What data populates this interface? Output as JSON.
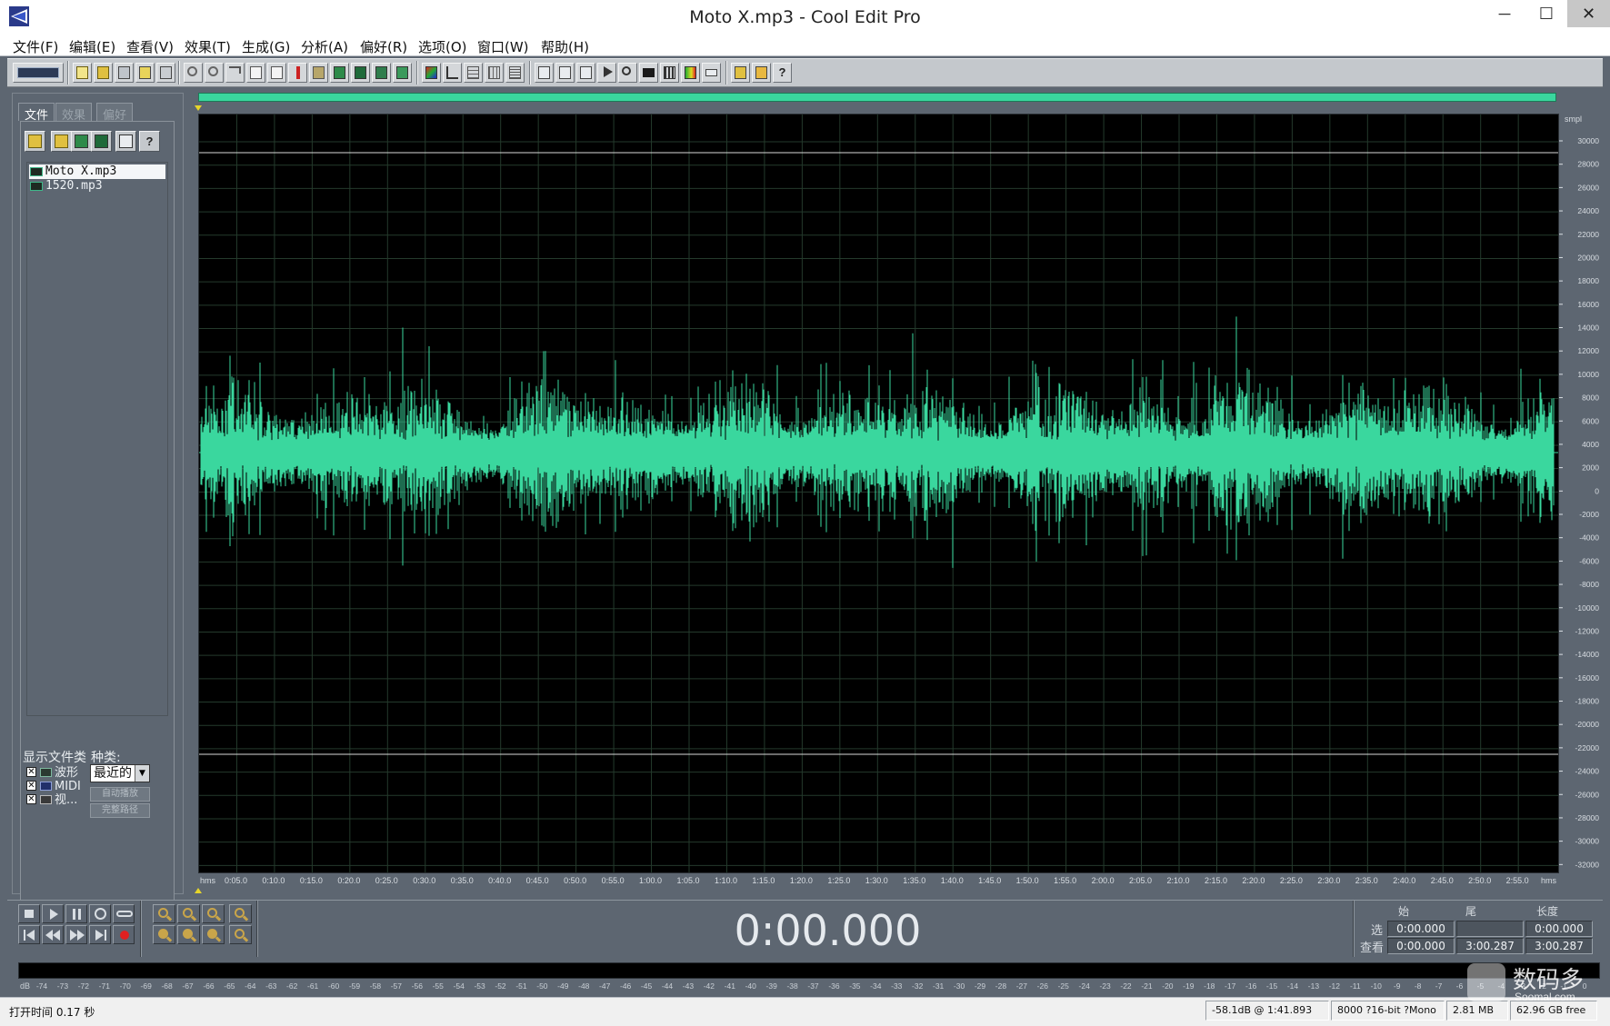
{
  "window": {
    "title": "Moto X.mp3 - Cool Edit Pro",
    "minimize_glyph": "─",
    "maximize_glyph": "☐",
    "close_glyph": "✕"
  },
  "menu": {
    "items": [
      "文件(F)",
      "编辑(E)",
      "查看(V)",
      "效果(T)",
      "生成(G)",
      "分析(A)",
      "偏好(R)",
      "选项(O)",
      "窗口(W)",
      "帮助(H)"
    ]
  },
  "organizer": {
    "tabs": [
      "文件",
      "效果",
      "偏好"
    ],
    "files": [
      {
        "name": "Moto X.mp3",
        "selected": true
      },
      {
        "name": "1520.mp3",
        "selected": false
      }
    ],
    "show_types_label": "显示文件类",
    "kind_label": "种类:",
    "types": [
      {
        "name": "波形",
        "checked": "✕"
      },
      {
        "name": "MIDI",
        "checked": "✕"
      },
      {
        "name": "视...",
        "checked": "✕"
      }
    ],
    "kind_value": "最近的",
    "auto_play_label": "自动播放",
    "full_path_label": "完整路径"
  },
  "waveform": {
    "wave_color": "#3ad79e",
    "background": "#000000",
    "grid_color": "#243a2c",
    "amp_unit": "smpl",
    "amp_ticks": [
      "30000",
      "28000",
      "26000",
      "24000",
      "22000",
      "20000",
      "18000",
      "16000",
      "14000",
      "12000",
      "10000",
      "8000",
      "6000",
      "4000",
      "2000",
      "0",
      "-2000",
      "-4000",
      "-6000",
      "-8000",
      "-10000",
      "-12000",
      "-14000",
      "-16000",
      "-18000",
      "-20000",
      "-22000",
      "-24000",
      "-26000",
      "-28000",
      "-30000",
      "-32000"
    ],
    "time_unit": "hms",
    "time_ticks": [
      "0:05.0",
      "0:10.0",
      "0:15.0",
      "0:20.0",
      "0:25.0",
      "0:30.0",
      "0:35.0",
      "0:40.0",
      "0:45.0",
      "0:50.0",
      "0:55.0",
      "1:00.0",
      "1:05.0",
      "1:10.0",
      "1:15.0",
      "1:20.0",
      "1:25.0",
      "1:30.0",
      "1:35.0",
      "1:40.0",
      "1:45.0",
      "1:50.0",
      "1:55.0",
      "2:00.0",
      "2:05.0",
      "2:10.0",
      "2:15.0",
      "2:20.0",
      "2:25.0",
      "2:30.0",
      "2:35.0",
      "2:40.0",
      "2:45.0",
      "2:50.0",
      "2:55.0"
    ]
  },
  "transport": {
    "time": "0:00.000",
    "headers": [
      "始",
      "尾",
      "长度"
    ],
    "row_select_label": "选",
    "row_view_label": "查看",
    "select": {
      "begin": "0:00.000",
      "end": "",
      "length": "0:00.000"
    },
    "view": {
      "begin": "0:00.000",
      "end": "3:00.287",
      "length": "3:00.287"
    }
  },
  "meter": {
    "unit": "dB",
    "ticks": [
      "-74",
      "-73",
      "-72",
      "-71",
      "-70",
      "-69",
      "-68",
      "-67",
      "-66",
      "-65",
      "-64",
      "-63",
      "-62",
      "-61",
      "-60",
      "-59",
      "-58",
      "-57",
      "-56",
      "-55",
      "-54",
      "-53",
      "-52",
      "-51",
      "-50",
      "-49",
      "-48",
      "-47",
      "-46",
      "-45",
      "-44",
      "-43",
      "-42",
      "-41",
      "-40",
      "-39",
      "-38",
      "-37",
      "-36",
      "-35",
      "-34",
      "-33",
      "-32",
      "-31",
      "-30",
      "-29",
      "-28",
      "-27",
      "-26",
      "-25",
      "-24",
      "-23",
      "-22",
      "-21",
      "-20",
      "-19",
      "-18",
      "-17",
      "-16",
      "-15",
      "-14",
      "-13",
      "-12",
      "-11",
      "-10",
      "-9",
      "-8",
      "-7",
      "-6",
      "-5",
      "-4",
      "-3",
      "-2",
      "-1",
      "0"
    ]
  },
  "status": {
    "open_time": "打开时间  0.17 秒",
    "level": "-58.1dB @  1:41.893",
    "format": "8000 ?16-bit ?Mono",
    "size": "2.81 MB",
    "free": "62.96 GB free"
  },
  "watermark": {
    "text": "数码多",
    "sub": "Soomal.com"
  }
}
